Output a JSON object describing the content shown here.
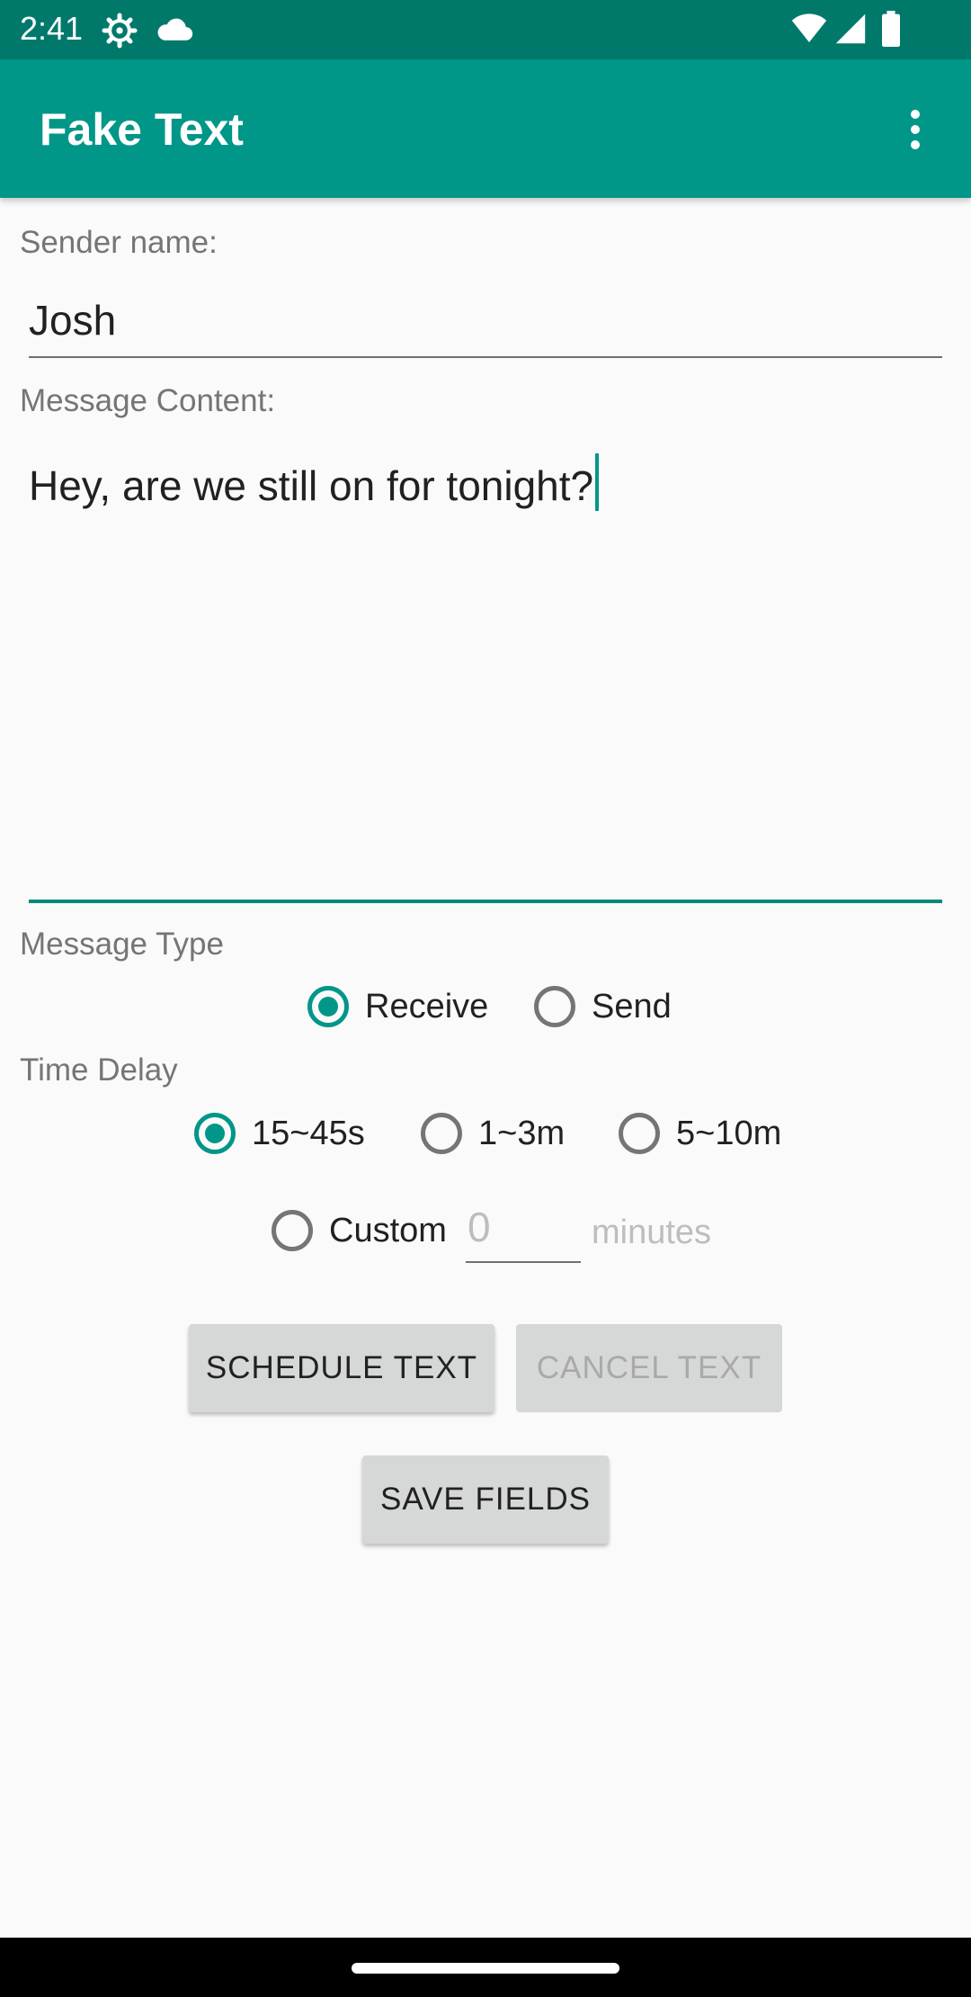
{
  "status_bar": {
    "time": "2:41",
    "icons": [
      "settings-icon",
      "cloud-icon",
      "wifi-icon",
      "signal-icon",
      "battery-icon"
    ]
  },
  "app_bar": {
    "title": "Fake Text",
    "menu_icon": "more-vert-icon"
  },
  "form": {
    "sender_label": "Sender name:",
    "sender_value": "Josh",
    "message_label": "Message Content:",
    "message_value": "Hey, are we still on for tonight?",
    "message_type_label": "Message Type",
    "message_type_options": [
      {
        "label": "Receive",
        "checked": true
      },
      {
        "label": "Send",
        "checked": false
      }
    ],
    "time_delay_label": "Time Delay",
    "time_delay_options": [
      {
        "label": "15~45s",
        "checked": true
      },
      {
        "label": "1~3m",
        "checked": false
      },
      {
        "label": "5~10m",
        "checked": false
      }
    ],
    "custom_option": {
      "label": "Custom",
      "checked": false
    },
    "custom_placeholder": "0",
    "minutes_label": "minutes"
  },
  "buttons": {
    "schedule": "SCHEDULE TEXT",
    "cancel": "CANCEL TEXT",
    "save": "SAVE FIELDS"
  },
  "colors": {
    "status_bar": "#00796B",
    "app_bar": "#009688",
    "accent": "#009688",
    "background": "#FAFAFA",
    "button": "#D6D7D7"
  }
}
